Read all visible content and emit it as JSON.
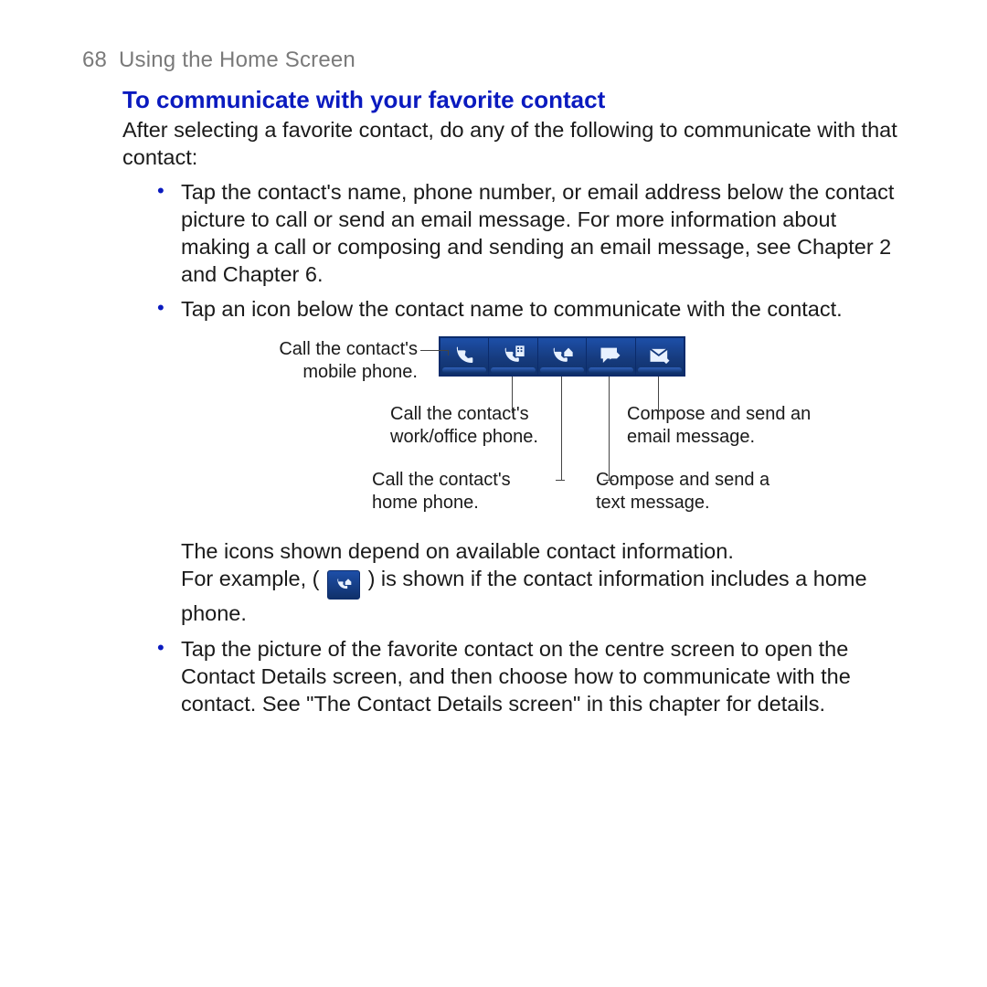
{
  "header": {
    "page_number": "68",
    "chapter_title": "Using the Home Screen"
  },
  "section_heading": "To communicate with your favorite contact",
  "intro": "After selecting a favorite contact, do any of the following to communicate with that contact:",
  "bullets": {
    "b1": "Tap the contact's name, phone number, or email address below the contact picture to call or send an email message. For more information about making a call or composing and sending an email message, see Chapter 2 and Chapter 6.",
    "b2": "Tap an icon below the contact name to communicate with the contact.",
    "b3": "Tap the picture of the favorite contact on the centre screen to open the Contact Details screen, and then choose how to communicate with the contact. See \"The Contact Details screen\" in this chapter for details."
  },
  "diagram": {
    "mobile": "Call the contact's mobile phone.",
    "work": "Call the contact's work/office phone.",
    "home": "Call the contact's home phone.",
    "text": "Compose and send a text message.",
    "email": "Compose and send an email message."
  },
  "note": {
    "line1": "The icons shown depend on available contact information.",
    "pre": "For example, (",
    "post": ") is shown if the contact information includes a home phone."
  }
}
